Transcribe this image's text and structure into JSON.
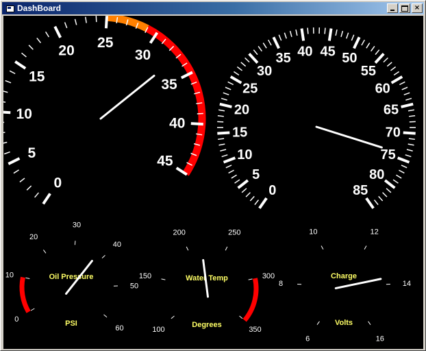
{
  "window": {
    "title": "DashBoard",
    "icon": "app-window-icon",
    "controls": [
      {
        "name": "minimize-button",
        "glyph": "minimize-icon"
      },
      {
        "name": "maximize-button",
        "glyph": "maximize-icon"
      },
      {
        "name": "close-button",
        "glyph": "close-icon",
        "label": "×"
      }
    ]
  },
  "colors": {
    "background": "#000000",
    "tick": "#ffffff",
    "needle": "#ffffff",
    "label": "#ffffff",
    "title": "#ffff66",
    "redzone": "#ff0000",
    "warnzone": "#ff8000"
  },
  "gauges": [
    {
      "id": "boost-gauge",
      "labels": [
        "0",
        "5",
        "10",
        "15",
        "20",
        "25",
        "30",
        "35",
        "40",
        "45"
      ],
      "min": 0,
      "max": 45,
      "value": 33,
      "bands": [
        {
          "from": 25,
          "to": 29,
          "color": "#ff8000"
        },
        {
          "from": 29,
          "to": 45,
          "color": "#ff0000"
        }
      ],
      "title": "",
      "subtitle": ""
    },
    {
      "id": "speedometer-gauge",
      "labels": [
        "0",
        "5",
        "10",
        "15",
        "20",
        "25",
        "30",
        "35",
        "40",
        "45",
        "50",
        "55",
        "60",
        "65",
        "70",
        "75",
        "80",
        "85"
      ],
      "min": 0,
      "max": 85,
      "value": 74,
      "bands": [],
      "title": "",
      "subtitle": ""
    },
    {
      "id": "oil-pressure-gauge",
      "labels": [
        "0",
        "10",
        "20",
        "30",
        "40",
        "50",
        "60"
      ],
      "min": 0,
      "max": 60,
      "value": 38,
      "bands": [
        {
          "from": 0,
          "to": 10,
          "color": "#ff0000"
        }
      ],
      "title": "Oil Pressure",
      "subtitle": "PSI"
    },
    {
      "id": "water-temp-gauge",
      "labels": [
        "100",
        "150",
        "200",
        "250",
        "300",
        "350"
      ],
      "min": 100,
      "max": 350,
      "value": 218,
      "bands": [
        {
          "from": 300,
          "to": 350,
          "color": "#ff0000"
        }
      ],
      "title": "Water Temp",
      "subtitle": "Degrees"
    },
    {
      "id": "charge-gauge",
      "labels": [
        "6",
        "8",
        "10",
        "12",
        "14",
        "16"
      ],
      "min": 6,
      "max": 16,
      "value": 13.7,
      "bands": [],
      "title": "Charge",
      "subtitle": "Volts"
    }
  ]
}
